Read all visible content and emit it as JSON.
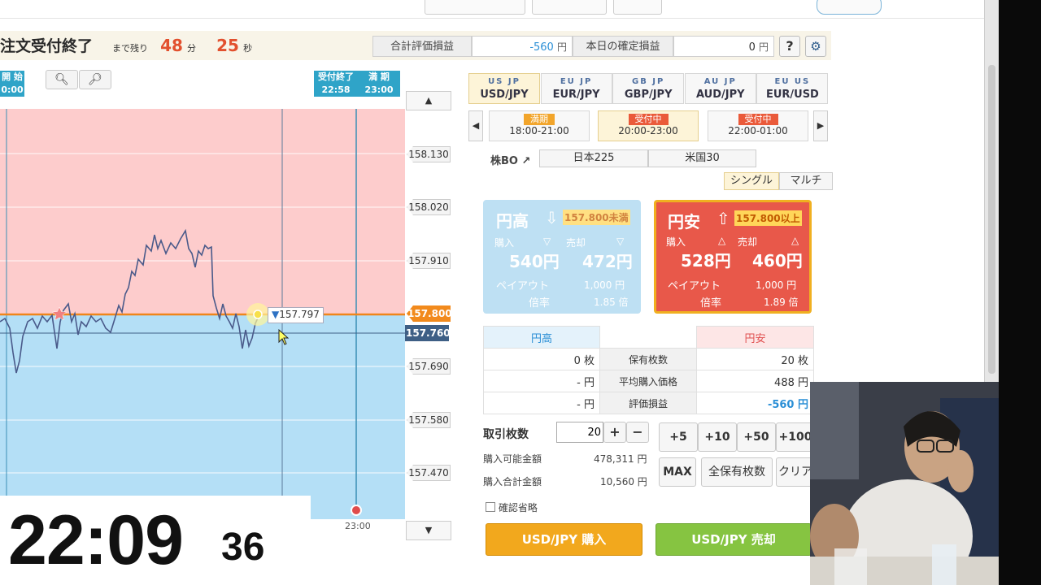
{
  "nav": {
    "items": [
      "",
      "",
      "",
      "",
      ""
    ]
  },
  "header": {
    "title": "注文受付終了",
    "remaining_label": "まで残り",
    "minutes": "48",
    "minutes_unit": "分",
    "seconds": "25",
    "seconds_unit": "秒",
    "eval_pl_label": "合計評価損益",
    "eval_pl_value": "-560",
    "eval_pl_unit": "円",
    "confirmed_pl_label": "本日の確定損益",
    "confirmed_pl_value": "0",
    "confirmed_pl_unit": "円",
    "help": "?"
  },
  "chart": {
    "start_flag": {
      "title": "開 始",
      "time": "0:00"
    },
    "end_flag": {
      "title": "受付終了",
      "time": "22:58"
    },
    "expiry_flag": {
      "title": "満 期",
      "time": "23:00"
    },
    "xtick": "23:00",
    "current_price": "157.797",
    "strike": "157.800",
    "last": "157.760"
  },
  "chart_data": {
    "type": "line",
    "y_ticks": [
      "158.130",
      "158.020",
      "157.910",
      "157.800",
      "157.760",
      "157.690",
      "157.580",
      "157.470"
    ],
    "x_ticks": [
      "23:00"
    ],
    "markers": [
      "157.797"
    ],
    "ylim": [
      157.4,
      158.2
    ]
  },
  "clock": {
    "hm": "22:09",
    "sec": "36"
  },
  "pairs": [
    {
      "label": "USD/JPY",
      "flags": "US JP",
      "selected": true
    },
    {
      "label": "EUR/JPY",
      "flags": "EU JP",
      "selected": false
    },
    {
      "label": "GBP/JPY",
      "flags": "GB JP",
      "selected": false
    },
    {
      "label": "AUD/JPY",
      "flags": "AU JP",
      "selected": false
    },
    {
      "label": "EUR/USD",
      "flags": "EU US",
      "selected": false
    }
  ],
  "slots": [
    {
      "tag": "満期",
      "time": "18:00-21:00",
      "tag_color": "#f2a52b",
      "selected": false
    },
    {
      "tag": "受付中",
      "time": "20:00-23:00",
      "tag_color": "#ea5a3a",
      "selected": true
    },
    {
      "tag": "受付中",
      "time": "22:00-01:00",
      "tag_color": "#ea5a3a",
      "selected": false
    }
  ],
  "stock": {
    "label": "株BO",
    "tabs": [
      "日本225",
      "米国30"
    ]
  },
  "mode": {
    "single": "シングル",
    "multi": "マルチ"
  },
  "cards": {
    "up": {
      "name": "円高",
      "threshold": "157.800未満",
      "buy_label": "購入",
      "sell_label": "売却",
      "buy": "540円",
      "sell": "472円",
      "payout_label": "ペイアウト",
      "payout": "1,000 円",
      "rate_label": "倍率",
      "rate": "1.85 倍"
    },
    "down": {
      "name": "円安",
      "threshold": "157.800以上",
      "buy_label": "購入",
      "sell_label": "売却",
      "buy": "528円",
      "sell": "460円",
      "payout_label": "ペイアウト",
      "payout": "1,000 円",
      "rate_label": "倍率",
      "rate": "1.89 倍"
    }
  },
  "positions": {
    "head_up": "円高",
    "head_down": "円安",
    "rows": [
      {
        "label": "保有枚数",
        "up": "0 枚",
        "down": "20 枚"
      },
      {
        "label": "平均購入価格",
        "up": "- 円",
        "down": "488 円"
      },
      {
        "label": "評価損益",
        "up": "- 円",
        "down": "-560 円"
      }
    ]
  },
  "order": {
    "qty_label": "取引枚数",
    "qty": "20",
    "plus": "+",
    "minus": "−",
    "available_label": "購入可能金額",
    "available": "478,311 円",
    "total_label": "購入合計金額",
    "total": "10,560 円",
    "quick": [
      "+5",
      "+10",
      "+50",
      "+100"
    ],
    "max": "MAX",
    "all": "全保有枚数",
    "clear": "クリア",
    "confirm": "確認省略",
    "buy_btn": "USD/JPY 購入",
    "sell_btn": "USD/JPY 売却"
  },
  "colors": {
    "up_zone": "#b4dff6",
    "down_zone": "#fdcccc",
    "strike": "#f0851a",
    "buy": "#f2a81d",
    "sell": "#86c441"
  }
}
